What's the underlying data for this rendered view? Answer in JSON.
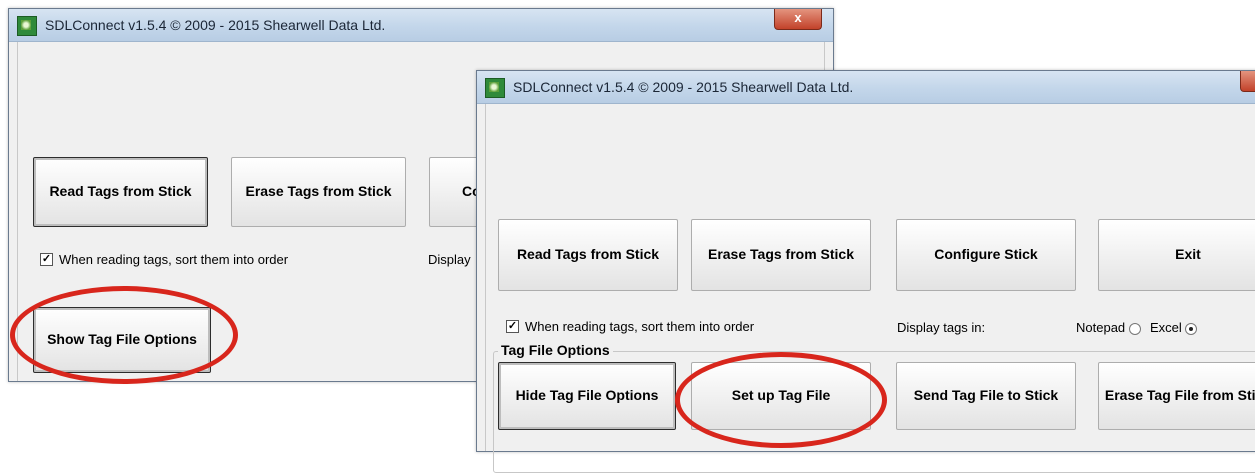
{
  "window1": {
    "title": "SDLConnect v1.5.4 © 2009 - 2015 Shearwell Data Ltd.",
    "close_glyph": "x",
    "buttons": {
      "read": "Read Tags from Stick",
      "erase": "Erase Tags from Stick",
      "configure_partial": "Co",
      "show_options": "Show Tag File Options"
    },
    "sort_checkbox": {
      "label": "When reading tags, sort them into order",
      "checked": true,
      "mark": "✓"
    },
    "display_partial": "Display"
  },
  "window2": {
    "title": "SDLConnect v1.5.4 © 2009 - 2015 Shearwell Data Ltd.",
    "buttons": {
      "read": "Read Tags from Stick",
      "erase": "Erase Tags from Stick",
      "configure": "Configure Stick",
      "exit": "Exit"
    },
    "sort_checkbox": {
      "label": "When reading tags, sort them into order",
      "checked": true,
      "mark": "✓"
    },
    "display_tags": {
      "label": "Display tags in:",
      "options": [
        "Notepad",
        "Excel"
      ],
      "selected": "Excel"
    },
    "tag_file_options": {
      "group_title": "Tag File Options",
      "hide": "Hide Tag File Options",
      "setup": "Set up Tag File",
      "send": "Send Tag File to Stick",
      "erase_file": "Erase Tag File from Stick"
    }
  },
  "colors": {
    "highlight_ellipse": "#d8261c",
    "titlebar": "#c3d6ea",
    "window_bg": "#f0f0f0"
  }
}
